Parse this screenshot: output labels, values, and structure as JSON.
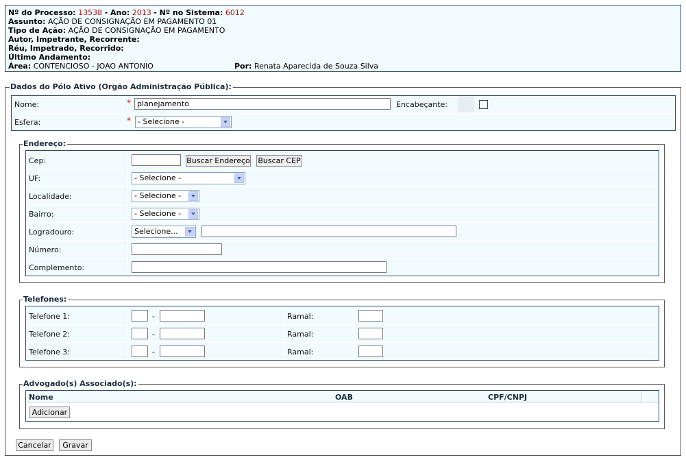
{
  "process": {
    "numero_label": "Nº do Processo:",
    "numero": "13538",
    "ano_label": "- Ano:",
    "ano": "2013",
    "sistema_label": "- Nº no Sistema:",
    "sistema": "6012",
    "assunto_label": "Assunto:",
    "assunto": "AÇÃO DE CONSIGNAÇÃO EM PAGAMENTO 01",
    "tipo_label": "Tipo de Ação:",
    "tipo": "AÇÃO DE CONSIGNAÇÃO EM PAGAMENTO",
    "autor_label": "Autor, Impetrante, Recorrente:",
    "reu_label": "Réu, Impetrado, Recorrido:",
    "andamento_label": "Último Andamento:",
    "area_label": "Área:",
    "area": "CONTENCIOSO - JOAO ANTONIO",
    "por_label": "Por:",
    "por": "Renata Aparecida de Souza Silva"
  },
  "polo": {
    "legend": "Dados do Pólo Ativo (Orgão Administração Pública):",
    "nome_label": "Nome:",
    "nome_value": "planejamento",
    "required_mark": "*",
    "encabecante_label": "Encabeçante:",
    "esfera_label": "Esfera:",
    "esfera_value": "- Selecione -"
  },
  "endereco": {
    "legend": "Endereço:",
    "cep_label": "Cep:",
    "buscar_endereco": "Buscar Endereço",
    "buscar_cep": "Buscar CEP",
    "uf_label": "UF:",
    "uf_value": "- Selecione -",
    "localidade_label": "Localidade:",
    "localidade_value": "- Selecione -",
    "bairro_label": "Bairro:",
    "bairro_value": "- Selecione -",
    "logradouro_label": "Logradouro:",
    "logradouro_value": "Selecione...",
    "numero_label": "Número:",
    "complemento_label": "Complemento:"
  },
  "telefones": {
    "legend": "Telefones:",
    "dash": "-",
    "ramal_label": "Ramal:",
    "rows": [
      "Telefone 1:",
      "Telefone 2:",
      "Telefone 3:"
    ]
  },
  "advogados": {
    "legend": "Advogado(s) Associado(s):",
    "col_nome": "Nome",
    "col_oab": "OAB",
    "col_cpf": "CPF/CNPJ",
    "adicionar": "Adicionar"
  },
  "actions": {
    "cancelar": "Cancelar",
    "gravar": "Gravar"
  },
  "colors": {
    "panel_bg": "#f1fafd",
    "border": "#2e4a63",
    "required": "#d01010",
    "highlight": "#a01010"
  }
}
